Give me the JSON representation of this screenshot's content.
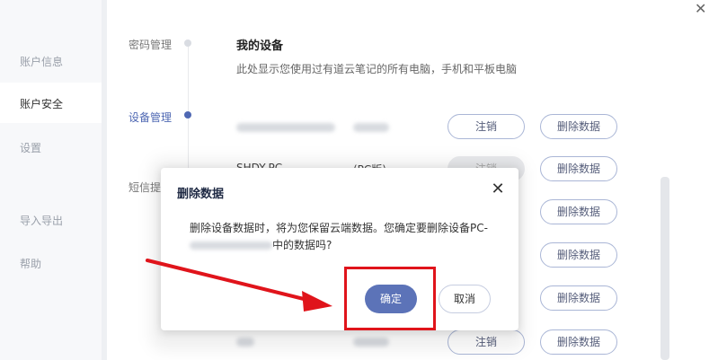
{
  "window": {
    "close_symbol": "✕"
  },
  "sidebar": {
    "items": [
      {
        "label": "账户信息"
      },
      {
        "label": "账户安全"
      },
      {
        "label": "设置"
      },
      {
        "label": "导入导出"
      },
      {
        "label": "帮助"
      }
    ]
  },
  "steps": [
    {
      "label": "密码管理"
    },
    {
      "label": "设备管理"
    },
    {
      "label": "短信提"
    }
  ],
  "devices": {
    "title": "我的设备",
    "description": "此处显示您使用过有道云笔记的所有电脑，手机和平板电脑",
    "visible_name": "SHDY-PC",
    "visible_type": "(PC版)",
    "logout_label": "注销",
    "delete_label": "删除数据",
    "logout_disabled_label": "注销"
  },
  "dialog": {
    "title": "删除数据",
    "message_line1": "删除设备数据时，将为您保留云端数据。您确定要删除设备PC-",
    "message_line2_suffix": "中的数据吗?",
    "confirm_label": "确定",
    "cancel_label": "取消",
    "close_symbol": "✕"
  },
  "annotation": {
    "color": "#e0141b"
  },
  "colors": {
    "accent": "#5c73b8",
    "sidebar_bg": "#f7f8fa"
  }
}
